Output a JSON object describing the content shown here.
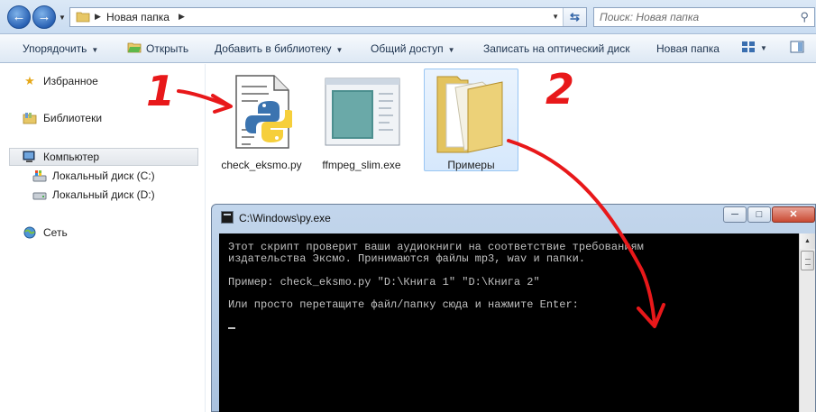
{
  "address_bar": {
    "crumb": "Новая папка",
    "search_placeholder": "Поиск: Новая папка"
  },
  "commands": {
    "organize": "Упорядочить",
    "open": "Открыть",
    "add_to_library": "Добавить в библиотеку",
    "share": "Общий доступ",
    "burn": "Записать на оптический диск",
    "new_folder": "Новая папка"
  },
  "nav": {
    "favorites": "Избранное",
    "libraries": "Библиотеки",
    "computer": "Компьютер",
    "disk_c": "Локальный диск (C:)",
    "disk_d": "Локальный диск (D:)",
    "network": "Сеть"
  },
  "files": [
    {
      "name": "check_eksmo.py",
      "icon": "python-file-icon"
    },
    {
      "name": "ffmpeg_slim.exe",
      "icon": "exe-window-icon"
    },
    {
      "name": "Примеры",
      "icon": "folder-icon"
    }
  ],
  "console": {
    "title": "C:\\Windows\\py.exe",
    "lines": [
      "Этот скрипт проверит ваши аудиокниги на соответствие требованиям",
      "издательства Эксмо. Принимаются файлы mp3, wav и папки.",
      "",
      "Пример: check_eksmo.py \"D:\\Книга 1\" \"D:\\Книга 2\"",
      "",
      "Или просто перетащите файл/папку сюда и нажмите Enter:"
    ]
  },
  "annotations": {
    "one": "1",
    "two": "2",
    "color": "#e8181a"
  }
}
